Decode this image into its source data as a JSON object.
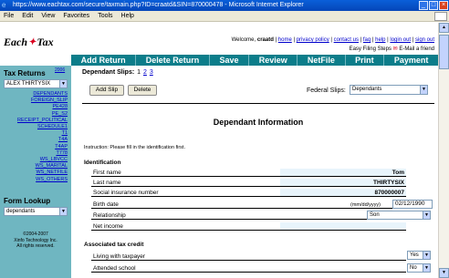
{
  "window": {
    "title": "https://www.eachtax.com/secure/taxmain.php?ID=craatd&SIN=870000478 - Microsoft Internet Explorer"
  },
  "menu": [
    "File",
    "Edit",
    "View",
    "Favorites",
    "Tools",
    "Help"
  ],
  "header": {
    "brand_left": "Each",
    "brand_right": "Tax",
    "welcome_prefix": "Welcome,",
    "username": "craatd",
    "links": [
      "home",
      "privacy policy",
      "contact us",
      "faq",
      "help",
      "login out",
      "sign out"
    ],
    "easy_filing": "Easy Filing Steps",
    "email_friend": "E-Mail a friend"
  },
  "nav": [
    "Add Return",
    "Delete Return",
    "Save",
    "Review",
    "NetFile",
    "Print",
    "Payment"
  ],
  "sidebar": {
    "returns_title": "Tax Returns",
    "returns_sup": "2006",
    "return_select": "ALEX THIRTYSIX",
    "links": [
      "DEPENDANTS",
      "FOREIGN_SLIP",
      "PE428",
      "PE_S2",
      "RECEIPT_POLITICAL",
      "SCHEDULE1",
      "T1",
      "T4A",
      "T4AP",
      "T778",
      "WS_LBVCC",
      "WS_MARITAL",
      "WS_NETFILE",
      "WS_OTHERS"
    ],
    "form_lookup_title": "Form Lookup",
    "form_lookup_select": "dependants",
    "copyright_lines": [
      "©2004-2007",
      "Xinfo Technology Inc.",
      "All rights reserved."
    ]
  },
  "main": {
    "slips_label": "Dependant Slips:",
    "slip_pages": [
      "1",
      "2",
      "3"
    ],
    "add_slip": "Add Slip",
    "delete": "Delete",
    "federal_slips_label": "Federal Slips:",
    "federal_slips_value": "Dependants",
    "section_title": "Dependant Information",
    "instruction": "Instruction: Please fill in the identification first.",
    "identification_heading": "Identification",
    "fields": {
      "first_name": {
        "label": "First name",
        "value": "Tom"
      },
      "last_name": {
        "label": "Last name",
        "value": "THIRTYSIX"
      },
      "sin": {
        "label": "Social insurance number",
        "value": "870000007"
      },
      "birth_date": {
        "label": "Birth date",
        "hint": "(mm/dd/yyyy)",
        "value": "02/12/1990"
      },
      "relationship": {
        "label": "Relationship",
        "value": "Son"
      },
      "net_income": {
        "label": "Net income",
        "value": ""
      }
    },
    "associated_heading": "Associated tax credit",
    "credits": {
      "living": {
        "label": "Living with taxpayer",
        "value": "Yes"
      },
      "school": {
        "label": "Attended school",
        "value": "No"
      }
    }
  }
}
